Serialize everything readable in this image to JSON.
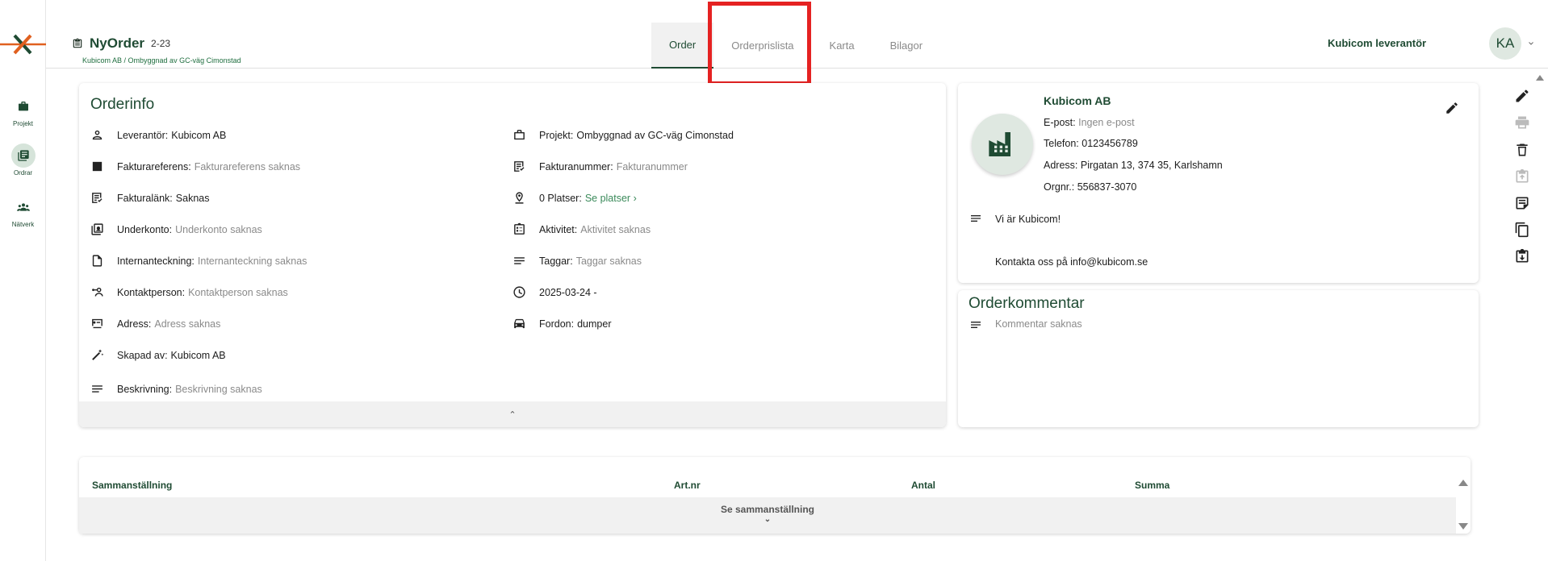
{
  "header": {
    "title": "NyOrder",
    "order_no": "2-23",
    "breadcrumb": "Kubicom AB / Ombyggnad av GC-väg Cimonstad",
    "tabs": [
      "Order",
      "Orderprislista",
      "Karta",
      "Bilagor"
    ],
    "active_tab": "Order",
    "user_name": "Kubicom leverantör",
    "avatar_initials": "KA"
  },
  "sidebar": {
    "items": [
      {
        "label": "Projekt",
        "icon": "briefcase-icon"
      },
      {
        "label": "Ordrar",
        "icon": "orders-icon",
        "active": true
      },
      {
        "label": "Nätverk",
        "icon": "network-icon"
      }
    ]
  },
  "orderinfo": {
    "title": "Orderinfo",
    "left": [
      {
        "label": "Leverantör:",
        "value": "Kubicom AB",
        "muted": false
      },
      {
        "label": "Fakturareferens:",
        "value": "Fakturareferens saknas",
        "muted": true
      },
      {
        "label": "Fakturalänk:",
        "value": "Saknas",
        "muted": false
      },
      {
        "label": "Underkonto:",
        "value": "Underkonto saknas",
        "muted": true
      },
      {
        "label": "Internanteckning:",
        "value": "Internanteckning saknas",
        "muted": true
      },
      {
        "label": "Kontaktperson:",
        "value": "Kontaktperson saknas",
        "muted": true
      },
      {
        "label": "Adress:",
        "value": "Adress saknas",
        "muted": true
      },
      {
        "label": "Skapad av:",
        "value": "Kubicom AB",
        "muted": false
      },
      {
        "label": "Beskrivning:",
        "value": "Beskrivning saknas",
        "muted": true
      }
    ],
    "right": [
      {
        "label": "Projekt:",
        "value": "Ombyggnad av GC-väg Cimonstad",
        "muted": false
      },
      {
        "label": "Fakturanummer:",
        "value": "Fakturanummer",
        "muted": true
      },
      {
        "label": "0 Platser:",
        "value": "Se platser ›",
        "link": true
      },
      {
        "label": "Aktivitet:",
        "value": "Aktivitet saknas",
        "muted": true
      },
      {
        "label": "Taggar:",
        "value": "Taggar saknas",
        "muted": true
      },
      {
        "label": "",
        "value": "2025-03-24 -",
        "muted": false
      },
      {
        "label": "Fordon:",
        "value": "dumper",
        "muted": false
      }
    ],
    "expand_symbol": "⌃"
  },
  "supplier": {
    "name": "Kubicom AB",
    "email_label": "E-post:",
    "email_value": "Ingen e-post",
    "phone_label": "Telefon:",
    "phone_value": "0123456789",
    "address_label": "Adress:",
    "address_value": "Pirgatan 13, 374 35, Karlshamn",
    "orgnr_label": "Orgnr.:",
    "orgnr_value": "556837-3070",
    "note_line1": "Vi är Kubicom!",
    "note_line2": "Kontakta oss på info@kubicom.se"
  },
  "comment": {
    "title": "Orderkommentar",
    "text": "Kommentar saknas"
  },
  "summary": {
    "columns": [
      "Sammanställning",
      "Art.nr",
      "Antal",
      "Summa"
    ],
    "see_label": "Se sammanställning",
    "chevron": "⌄"
  }
}
